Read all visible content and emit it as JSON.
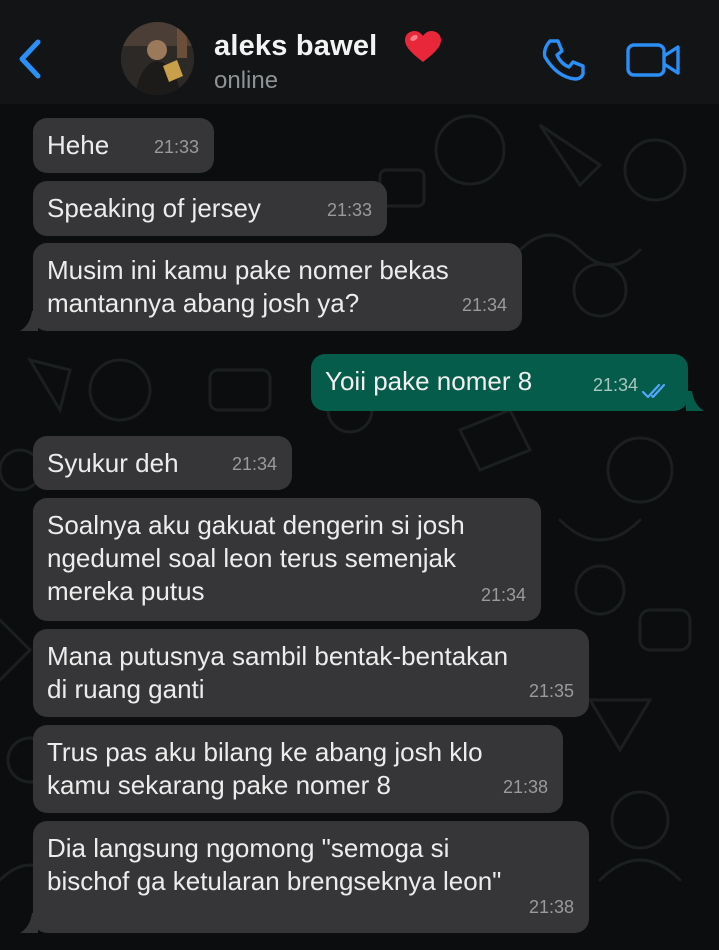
{
  "header": {
    "contact_name": "aleks bawel",
    "status": "online"
  },
  "messages": [
    {
      "text": "Hehe",
      "time": "21:33",
      "direction": "in"
    },
    {
      "text": "Speaking of jersey",
      "time": "21:33",
      "direction": "in"
    },
    {
      "text": "Musim ini kamu pake nomer bekas\nmantannya abang josh ya?",
      "time": "21:34",
      "direction": "in"
    },
    {
      "text": "Yoii pake nomer 8",
      "time": "21:34",
      "direction": "out",
      "status": "read"
    },
    {
      "text": "Syukur deh",
      "time": "21:34",
      "direction": "in"
    },
    {
      "text": "Soalnya aku gakuat dengerin si josh\nngedumel soal leon terus semenjak\nmereka putus",
      "time": "21:34",
      "direction": "in"
    },
    {
      "text": "Mana putusnya sambil bentak-bentakan\ndi ruang ganti",
      "time": "21:35",
      "direction": "in"
    },
    {
      "text": "Trus pas aku bilang ke abang josh klo\nkamu sekarang pake nomer 8",
      "time": "21:38",
      "direction": "in"
    },
    {
      "text": "Dia langsung ngomong \"semoga si\nbischof ga ketularan brengseknya leon\"",
      "time": "21:38",
      "direction": "in"
    }
  ],
  "colors": {
    "accent": "#2a8ff7",
    "incoming_bubble": "#363638",
    "outgoing_bubble": "#055c4b",
    "read_ticks": "#53a6fd",
    "heart": "#e8283a"
  },
  "icons": [
    "back-icon",
    "heart-icon",
    "call-icon",
    "video-call-icon",
    "read-ticks-icon"
  ]
}
